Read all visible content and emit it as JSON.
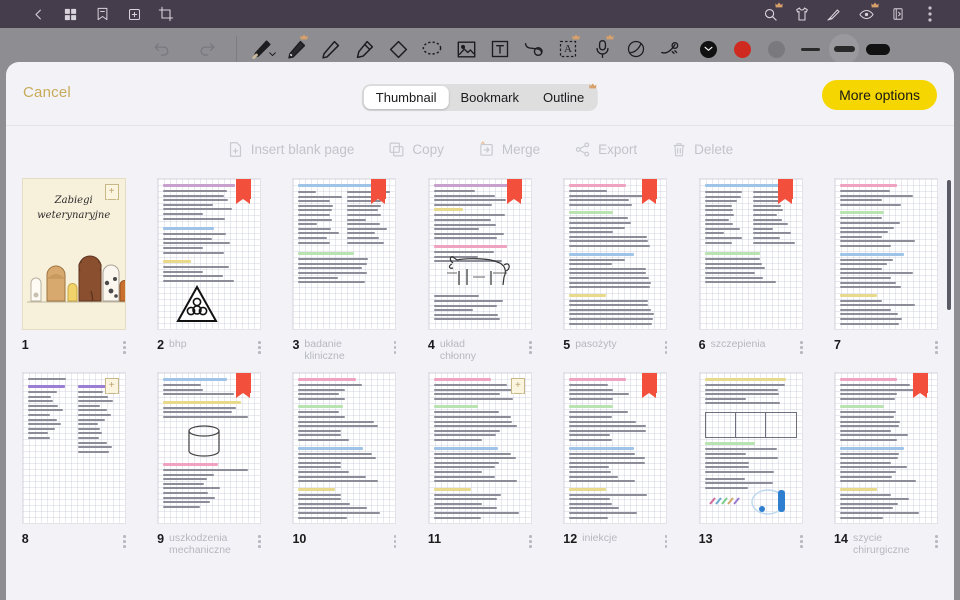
{
  "appbar": {
    "icons": [
      {
        "name": "back-chevron-icon",
        "label": "Back"
      },
      {
        "name": "grid-view-icon",
        "label": "Grid view"
      },
      {
        "name": "bookmark-icon",
        "label": "Bookmark"
      },
      {
        "name": "add-page-icon",
        "label": "Add page"
      },
      {
        "name": "crop-icon",
        "label": "Crop"
      }
    ],
    "right_icons": [
      {
        "name": "search-icon",
        "label": "Search",
        "premium": true
      },
      {
        "name": "shirt-icon",
        "label": "Template"
      },
      {
        "name": "pen-nib-icon",
        "label": "Ink"
      },
      {
        "name": "eye-icon",
        "label": "View",
        "premium": true
      },
      {
        "name": "page-flip-icon",
        "label": "Page flip"
      },
      {
        "name": "overflow-menu-icon",
        "label": "More"
      }
    ]
  },
  "toolbar": {
    "undo_label": "Undo",
    "redo_label": "Redo",
    "tools": [
      {
        "name": "fountain-pen-tool",
        "label": "Pen"
      },
      {
        "name": "pencil-tool",
        "label": "Pencil",
        "premium": true
      },
      {
        "name": "ballpoint-pen-tool",
        "label": "Ballpoint"
      },
      {
        "name": "highlighter-tool",
        "label": "Highlighter"
      },
      {
        "name": "eraser-tool",
        "label": "Eraser"
      },
      {
        "name": "lasso-select-tool",
        "label": "Lasso"
      },
      {
        "name": "image-tool",
        "label": "Image"
      },
      {
        "name": "text-box-tool",
        "label": "Text box"
      },
      {
        "name": "shape-tool",
        "label": "Shape"
      },
      {
        "name": "text-recognition-tool",
        "label": "Text recognition",
        "premium": true
      },
      {
        "name": "microphone-tool",
        "label": "Record",
        "premium": true
      },
      {
        "name": "color-wheel-tool",
        "label": "Color"
      },
      {
        "name": "ink-drop-tool",
        "label": "Ink drop"
      }
    ],
    "colors": [
      {
        "name": "color-swatch-black",
        "hex": "#111111",
        "selected": true
      },
      {
        "name": "color-swatch-red",
        "hex": "#cf2a20",
        "selected": false
      },
      {
        "name": "color-swatch-gray",
        "hex": "#79797e",
        "selected": false
      }
    ],
    "thicknesses": [
      {
        "name": "stroke-thin",
        "selected": false
      },
      {
        "name": "stroke-medium",
        "selected": true
      },
      {
        "name": "stroke-thick",
        "selected": false
      }
    ]
  },
  "panel": {
    "cancel_label": "Cancel",
    "more_options_label": "More options",
    "more_options_color": "#f5d600",
    "tabs": [
      {
        "label": "Thumbnail",
        "active": true,
        "premium": false
      },
      {
        "label": "Bookmark",
        "active": false,
        "premium": false
      },
      {
        "label": "Outline",
        "active": false,
        "premium": true
      }
    ],
    "actions": [
      {
        "label": "Insert blank page",
        "icon": "insert-page-icon",
        "enabled": false
      },
      {
        "label": "Copy",
        "icon": "copy-icon",
        "enabled": false
      },
      {
        "label": "Merge",
        "icon": "merge-icon",
        "enabled": false
      },
      {
        "label": "Export",
        "icon": "share-icon",
        "enabled": false
      },
      {
        "label": "Delete",
        "icon": "trash-icon",
        "enabled": false
      }
    ]
  },
  "cover": {
    "title_line1": "Zabiegi",
    "title_line2": "weterynaryjne"
  },
  "pages": [
    {
      "number": "1",
      "title": "",
      "bookmark": "add",
      "kind": "cover"
    },
    {
      "number": "2",
      "title": "bhp",
      "bookmark": "ribbon",
      "kind": "biohazard"
    },
    {
      "number": "3",
      "title": "badanie kliniczne",
      "bookmark": "ribbon",
      "kind": "twocol"
    },
    {
      "number": "4",
      "title": "układ chłonny",
      "bookmark": "ribbon",
      "kind": "dog"
    },
    {
      "number": "5",
      "title": "pasożyty",
      "bookmark": "ribbon",
      "kind": "notes"
    },
    {
      "number": "6",
      "title": "szczepienia",
      "bookmark": "ribbon",
      "kind": "twocol"
    },
    {
      "number": "7",
      "title": "",
      "bookmark": "none",
      "kind": "notes"
    },
    {
      "number": "8",
      "title": "",
      "bookmark": "add",
      "kind": "flow"
    },
    {
      "number": "9",
      "title": "uszkodzenia mechaniczne",
      "bookmark": "ribbon",
      "kind": "cylinder"
    },
    {
      "number": "10",
      "title": "",
      "bookmark": "none",
      "kind": "notes"
    },
    {
      "number": "11",
      "title": "",
      "bookmark": "add",
      "kind": "notes"
    },
    {
      "number": "12",
      "title": "iniekcje",
      "bookmark": "ribbon",
      "kind": "notes"
    },
    {
      "number": "13",
      "title": "",
      "bookmark": "none",
      "kind": "table"
    },
    {
      "number": "14",
      "title": "szycie chirurgiczne",
      "bookmark": "ribbon",
      "kind": "notes"
    }
  ]
}
